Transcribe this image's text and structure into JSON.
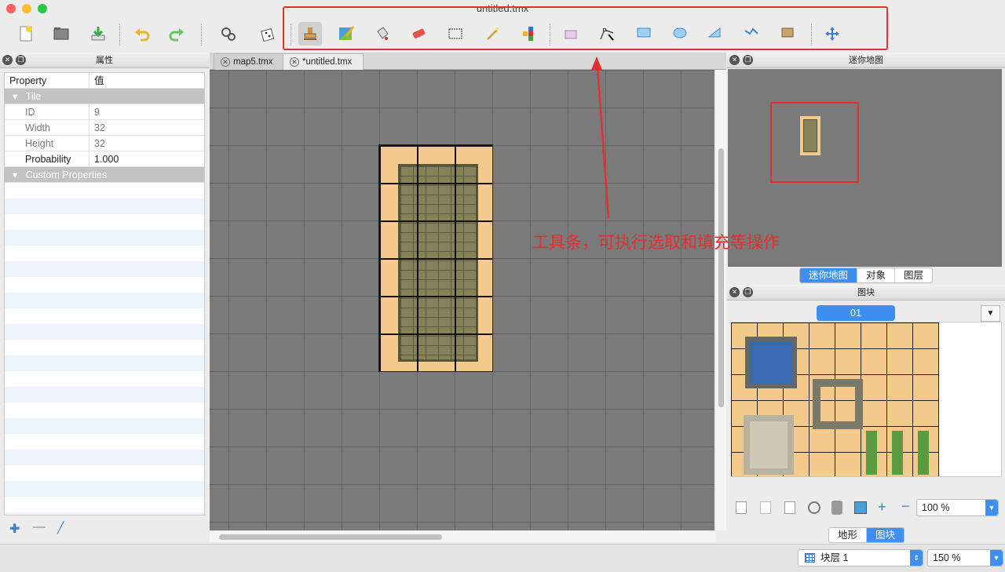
{
  "window": {
    "title": "untitled.tmx"
  },
  "properties_panel": {
    "title": "属性",
    "col_property": "Property",
    "col_value": "值",
    "group_tile": "Tile",
    "rows": [
      {
        "key": "ID",
        "value": "9"
      },
      {
        "key": "Width",
        "value": "32"
      },
      {
        "key": "Height",
        "value": "32"
      },
      {
        "key": "Probability",
        "value": "1.000"
      }
    ],
    "group_custom": "Custom Properties"
  },
  "tabs": [
    {
      "label": "map5.tmx"
    },
    {
      "label": "*untitled.tmx"
    }
  ],
  "minimap_panel": {
    "title": "迷你地图",
    "tabs": [
      "迷你地图",
      "对象",
      "图层"
    ]
  },
  "tileset_panel": {
    "title": "图块",
    "tileset_name": "01",
    "zoom": "100 %",
    "tabs": [
      "地形",
      "图块"
    ]
  },
  "status_bar": {
    "layer": "块层 1",
    "zoom": "150 %"
  },
  "annotation": "工具条，可执行选取和填充等操作",
  "colors": {
    "accent": "#3d8ff1",
    "annotation": "#e03030"
  }
}
